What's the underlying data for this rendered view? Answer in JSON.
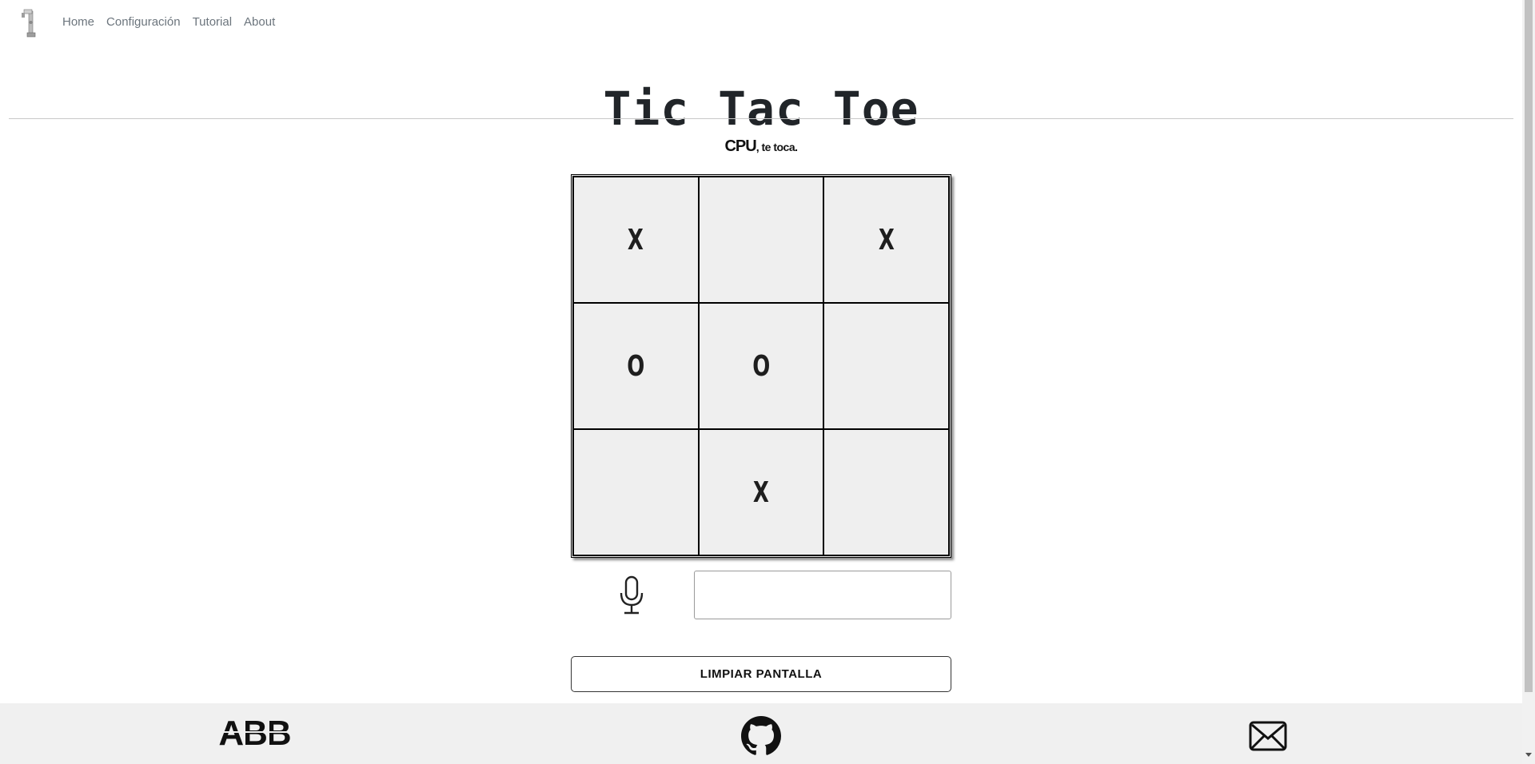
{
  "nav": {
    "logo_icon": "robot-arm-icon",
    "links": [
      "Home",
      "Configuración",
      "Tutorial",
      "About"
    ]
  },
  "title": "Tic Tac Toe",
  "turn": {
    "player": "CPU",
    "message": ", te toca."
  },
  "board": {
    "cells": [
      "X",
      "",
      "X",
      "O",
      "O",
      "",
      "",
      "X",
      ""
    ]
  },
  "voice": {
    "mic_icon": "microphone-icon",
    "input_value": ""
  },
  "clear_button": "LIMPIAR PANTALLA",
  "footer": {
    "abb_logo": "ABB",
    "github_icon": "github-icon",
    "mail_icon": "mail-icon"
  }
}
